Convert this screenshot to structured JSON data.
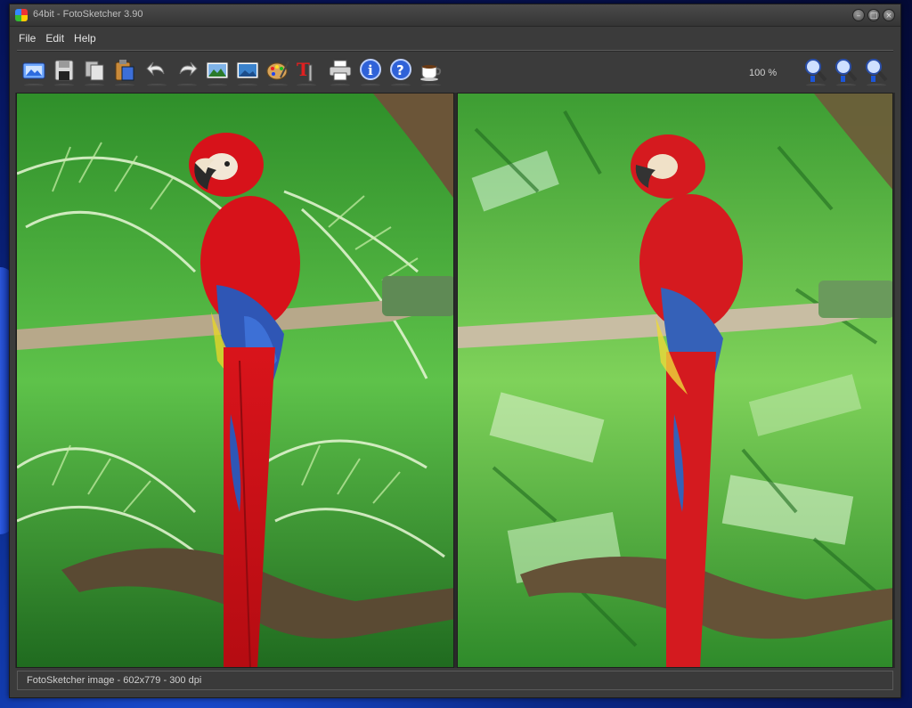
{
  "window": {
    "title": "64bit - FotoSketcher 3.90"
  },
  "menu": {
    "items": [
      "File",
      "Edit",
      "Help"
    ]
  },
  "toolbar": {
    "buttons": [
      {
        "name": "open-image-icon"
      },
      {
        "name": "save-icon"
      },
      {
        "name": "copy-icon"
      },
      {
        "name": "paste-icon"
      },
      {
        "name": "undo-icon"
      },
      {
        "name": "redo-icon"
      },
      {
        "name": "load-image-icon"
      },
      {
        "name": "image-settings-icon"
      },
      {
        "name": "palette-icon"
      },
      {
        "name": "text-tool-icon"
      },
      {
        "name": "print-icon"
      },
      {
        "name": "info-icon"
      },
      {
        "name": "help-icon"
      },
      {
        "name": "coffee-donate-icon"
      },
      {
        "name": "zoom-in-icon"
      },
      {
        "name": "zoom-reset-icon"
      },
      {
        "name": "zoom-out-icon"
      }
    ],
    "zoom_level": "100 %"
  },
  "status": {
    "text": "FotoSketcher image - 602x779 - 300 dpi"
  },
  "colors": {
    "parrot_red": "#d7121a",
    "parrot_blue": "#2f56b5",
    "leaf_green": "#36a82c",
    "branch_brown": "#6b5538"
  }
}
